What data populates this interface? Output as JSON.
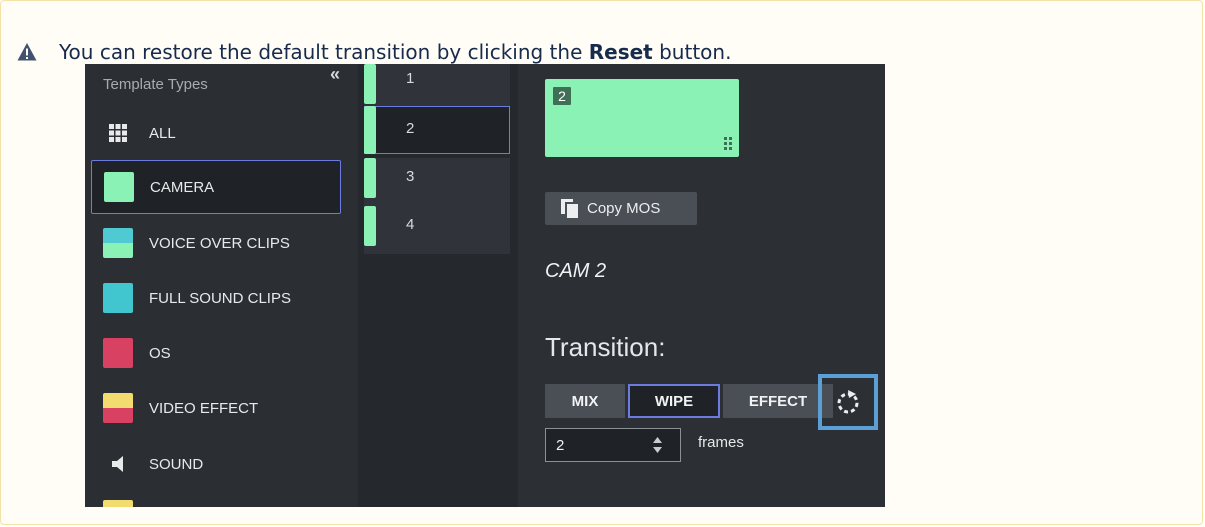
{
  "note": {
    "prefix": "You can restore the default transition by clicking the ",
    "bold": "Reset",
    "suffix": " button."
  },
  "left_panel": {
    "collapse_glyph": "«",
    "title": "Template Types",
    "items": [
      {
        "label": "ALL",
        "icon": "grid-icon"
      },
      {
        "label": "CAMERA",
        "icon": "camera-swatch"
      },
      {
        "label": "VOICE OVER CLIPS",
        "icon": "voice-over-swatch"
      },
      {
        "label": "FULL SOUND CLIPS",
        "icon": "full-sound-swatch"
      },
      {
        "label": "OS",
        "icon": "os-swatch"
      },
      {
        "label": "VIDEO EFFECT",
        "icon": "video-effect-swatch"
      },
      {
        "label": "SOUND",
        "icon": "speaker-icon"
      }
    ]
  },
  "slots": [
    "1",
    "2",
    "3",
    "4"
  ],
  "preview": {
    "badge": "2"
  },
  "copy_mos": {
    "label": "Copy MOS"
  },
  "cam_title": "CAM 2",
  "transition": {
    "label": "Transition:",
    "buttons": [
      "MIX",
      "WIPE",
      "EFFECT"
    ],
    "selected": "WIPE",
    "frames_value": "2",
    "frames_label": "frames"
  },
  "colors": {
    "camera": "#8af2b5",
    "selection_border": "#6c7be0",
    "reset_highlight": "#5aa0d6",
    "os": "#d84161",
    "full_sound": "#41c6d0",
    "video_effect_top": "#f3dc6f"
  }
}
